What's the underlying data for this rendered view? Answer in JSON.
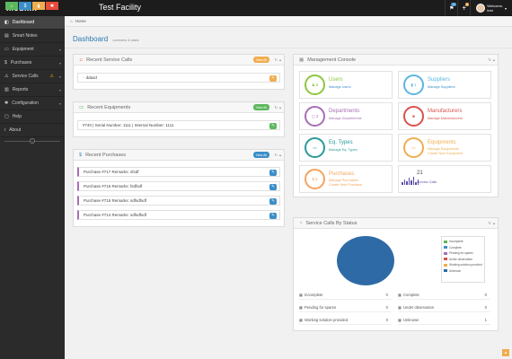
{
  "topbar": {
    "logo": "medixir",
    "facility": "Test Facility",
    "icons": [
      {
        "icon": "flag-icon",
        "glyph": "⚑",
        "badge": "22",
        "badge_color": "#3a8ec7"
      },
      {
        "icon": "bell-icon",
        "glyph": "🔔",
        "badge": "2",
        "badge_color": "#f0ad4e"
      }
    ],
    "welcome": "Welcome,",
    "username": "test"
  },
  "sidebar": {
    "buttons": [
      {
        "icon": "home-icon",
        "glyph": "⌂",
        "color": "#5cb85c"
      },
      {
        "icon": "dollar-icon",
        "glyph": "$",
        "color": "#3a8ec7"
      },
      {
        "icon": "chart-icon",
        "glyph": "▮",
        "color": "#f0ad4e"
      },
      {
        "icon": "settings-icon",
        "glyph": "✱",
        "color": "#e74c3c"
      }
    ],
    "items": [
      {
        "label": "Dashboard",
        "glyph": "◧",
        "icon": "dashboard-icon",
        "active": true,
        "arrow": false,
        "warn": false
      },
      {
        "label": "Smart Notes",
        "glyph": "▤",
        "icon": "notes-icon",
        "active": false,
        "arrow": false,
        "warn": false
      },
      {
        "label": "Equipment",
        "glyph": "▭",
        "icon": "monitor-icon",
        "active": false,
        "arrow": true,
        "warn": false
      },
      {
        "label": "Purchases",
        "glyph": "$",
        "icon": "dollar-icon",
        "active": false,
        "arrow": true,
        "warn": false
      },
      {
        "label": "Service Calls",
        "glyph": "⚠",
        "icon": "alert-icon",
        "active": false,
        "arrow": true,
        "warn": true
      },
      {
        "label": "Reports",
        "glyph": "▥",
        "icon": "reports-icon",
        "active": false,
        "arrow": true,
        "warn": false
      },
      {
        "label": "Configuration",
        "glyph": "✱",
        "icon": "gear-icon",
        "active": false,
        "arrow": true,
        "warn": false
      },
      {
        "label": "Help",
        "glyph": "▢",
        "icon": "help-icon",
        "active": false,
        "arrow": false,
        "warn": false
      },
      {
        "label": "About",
        "glyph": "i",
        "icon": "info-icon",
        "active": false,
        "arrow": false,
        "warn": false
      }
    ]
  },
  "breadcrumb": {
    "home": "Home"
  },
  "page": {
    "title": "Dashboard",
    "subtitle": "overview & stats"
  },
  "recent_service_calls": {
    "title": "Recent Service Calls",
    "view_all": "View All",
    "rows": [
      {
        "text": "ddasd"
      }
    ]
  },
  "recent_equipments": {
    "title": "Recent Equipments",
    "view_all": "View All",
    "rows": [
      {
        "text": "#740 | Serial Number: 1111 | Internal Number: 1111"
      }
    ]
  },
  "recent_purchases": {
    "title": "Recent Purchases",
    "view_all": "View All",
    "rows": [
      {
        "text": "Purchase #717 Remarks: sfsdf"
      },
      {
        "text": "Purchase #716 Remarks: fsdfsdf"
      },
      {
        "text": "Purchase #715 Remarks: sdfsdfsdf"
      },
      {
        "text": "Purchase #714 Remarks: sdfsdfsdf"
      }
    ]
  },
  "management_console": {
    "title": "Management Console",
    "cards": [
      {
        "title": "Users",
        "links": [
          "Manage Users"
        ],
        "count": "6",
        "color": "#8dc63f",
        "icon": "users-icon"
      },
      {
        "title": "Suppliers",
        "links": [
          "Manage Suppliers"
        ],
        "count": "1",
        "color": "#5bb6e0",
        "icon": "suppliers-icon"
      },
      {
        "title": "Departments",
        "links": [
          "Manage Departments"
        ],
        "count": "2",
        "color": "#a76fb5",
        "icon": "departments-icon"
      },
      {
        "title": "Manufacturers",
        "links": [
          "Manage Manufacturers"
        ],
        "count": "",
        "color": "#d9534f",
        "icon": "manufacturers-icon"
      },
      {
        "title": "Eq. Types",
        "links": [
          "Manage Eq. Types"
        ],
        "count": "",
        "color": "#2a9a9a",
        "icon": "eq-types-icon"
      },
      {
        "title": "Equipments",
        "links": [
          "Manage Equipments",
          "Create New Equipment"
        ],
        "count": "",
        "color": "#f0ad4e",
        "icon": "equipments-icon"
      },
      {
        "title": "Purchases",
        "links": [
          "Manage Purchases",
          "Create New Purchase"
        ],
        "count": "4",
        "color": "#f4a460",
        "icon": "purchases-icon"
      },
      {
        "title": "21",
        "links": [
          "Service Calls"
        ],
        "count": "",
        "color": "#5b4fa8",
        "icon": "bar-chart-icon"
      }
    ]
  },
  "service_calls_status": {
    "title": "Service Calls By Status",
    "legend": [
      {
        "label": "Incomplete",
        "color": "#5cb85c"
      },
      {
        "label": "Complete",
        "color": "#3a8ec7"
      },
      {
        "label": "Pending for spares",
        "color": "#a76fb5"
      },
      {
        "label": "Under observation",
        "color": "#d9534f"
      },
      {
        "label": "Working solution provided",
        "color": "#f0ad4e"
      },
      {
        "label": "Unknown",
        "color": "#2e6ba6"
      }
    ],
    "stats": [
      {
        "label": "Incomplete",
        "value": "0"
      },
      {
        "label": "Complete",
        "value": "0"
      },
      {
        "label": "Pending for spares",
        "value": "0"
      },
      {
        "label": "Under observation",
        "value": "0"
      },
      {
        "label": "Working solution provided",
        "value": "0"
      },
      {
        "label": "Unknown",
        "value": "1"
      }
    ]
  }
}
